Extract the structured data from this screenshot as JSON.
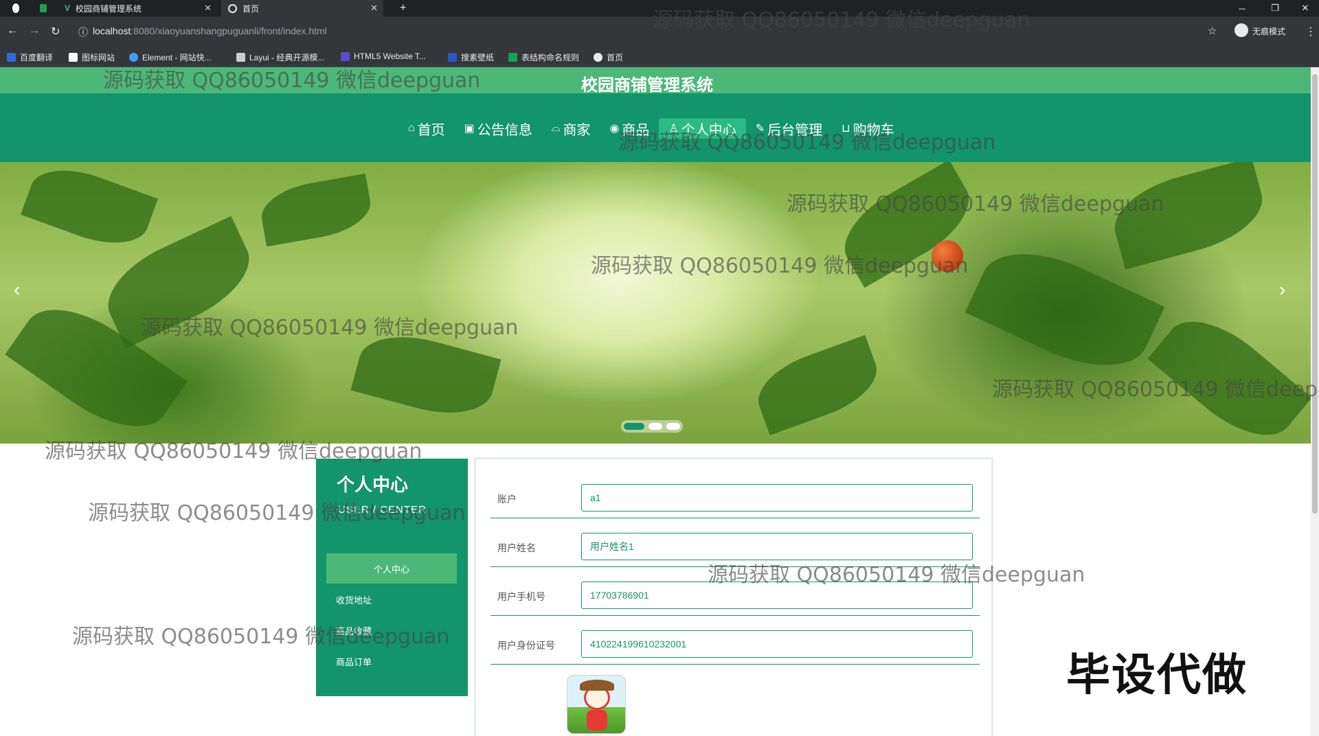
{
  "browser": {
    "tabs": [
      {
        "label": "",
        "icon": "github-icon"
      },
      {
        "label": "",
        "icon": "app-icon"
      },
      {
        "label": "校园商铺管理系统",
        "icon": "vue-icon"
      },
      {
        "label": "首页",
        "icon": "globe-icon"
      }
    ],
    "new_tab": "+",
    "url_host": "localhost",
    "url_path": ":8080/xiaoyuanshangpuguanli/front/index.html",
    "profile_label": "无痕模式",
    "bookmarks": [
      {
        "label": "百度翻译",
        "color": "#2f6bd8"
      },
      {
        "label": "图标网站",
        "color": "#ffffff"
      },
      {
        "label": "Element - 网站快...",
        "color": "#409eff"
      },
      {
        "label": "Layui - 经典开源模...",
        "color": "#cccccc"
      },
      {
        "label": "HTML5 Website T...",
        "color": "#5b4bd1"
      },
      {
        "label": "搜素壁纸",
        "color": "#2a56c6"
      },
      {
        "label": "表结构命名规则",
        "color": "#18a058"
      },
      {
        "label": "首页",
        "color": "#e8eaed"
      }
    ]
  },
  "site": {
    "title": "校园商铺管理系统",
    "nav": [
      {
        "label": "首页",
        "icon": "⌂"
      },
      {
        "label": "公告信息",
        "icon": "▣"
      },
      {
        "label": "商家",
        "icon": "⌓"
      },
      {
        "label": "商品",
        "icon": "◉"
      },
      {
        "label": "个人中心",
        "icon": "♙",
        "active": true
      },
      {
        "label": "后台管理",
        "icon": "✎"
      },
      {
        "label": "购物车",
        "icon": "⊔"
      }
    ]
  },
  "banner": {
    "slides": 3,
    "active_slide": 1
  },
  "sidebar": {
    "title": "个人中心",
    "subtitle": "USER / CENTER",
    "items": [
      {
        "label": "个人中心",
        "active": true
      },
      {
        "label": "收货地址"
      },
      {
        "label": "商品收藏"
      },
      {
        "label": "商品订单"
      }
    ]
  },
  "form": {
    "fields": [
      {
        "label": "账户",
        "value": "a1"
      },
      {
        "label": "用户姓名",
        "value": "用户姓名1"
      },
      {
        "label": "用户手机号",
        "value": "17703786901"
      },
      {
        "label": "用户身份证号",
        "value": "410224199610232001"
      }
    ]
  },
  "stamp": "毕设代做",
  "watermark": "源码获取 QQ86050149 微信deepguan",
  "colors": {
    "primary": "#13946a",
    "accent": "#4cb878",
    "active_nav": "#2cb983"
  }
}
